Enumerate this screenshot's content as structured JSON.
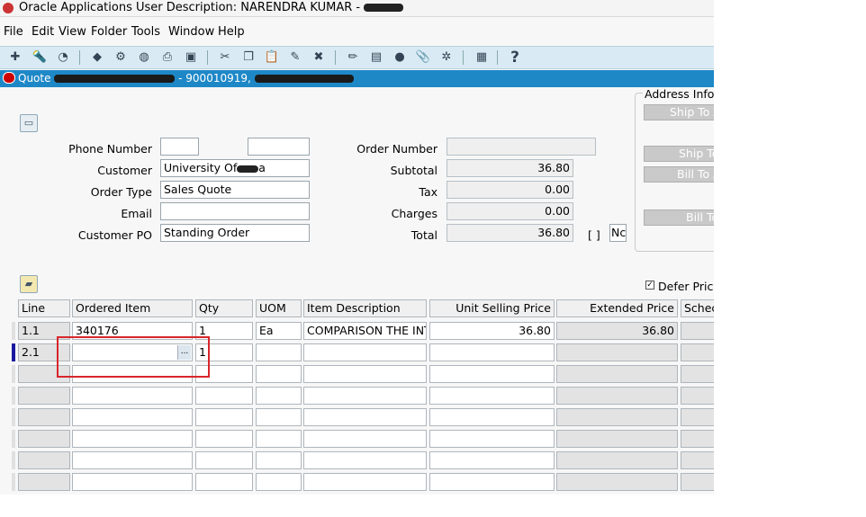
{
  "window": {
    "title": "Oracle Applications User Description: NARENDRA KUMAR -"
  },
  "menu": {
    "items": [
      "File",
      "Edit",
      "View",
      "Folder",
      "Tools",
      "Window",
      "Help"
    ]
  },
  "toolbar": {
    "icons": [
      "new-icon",
      "find-icon",
      "navigator-icon",
      "save-icon",
      "next-step-icon",
      "switch-responsibility-icon",
      "print-icon",
      "close-form-icon",
      "cut-icon",
      "copy-icon",
      "paste-icon",
      "clear-record-icon",
      "delete-record-icon",
      "edit-field-icon",
      "zoom-icon",
      "translations-icon",
      "attachments-icon",
      "folder-tools-icon",
      "window-help-icon",
      "help-icon"
    ],
    "help_glyph": "?"
  },
  "form": {
    "name": "Quote",
    "number": "- 900010919,"
  },
  "header": {
    "phone_label": "Phone Number",
    "phone_value1": "",
    "phone_value2": "",
    "customer_label": "Customer",
    "customer_value": "University Of",
    "customer_tail": "a",
    "order_type_label": "Order Type",
    "order_type_value": "Sales Quote",
    "email_label": "Email",
    "email_value": "",
    "customer_po_label": "Customer PO",
    "customer_po_value": "Standing Order",
    "order_number_label": "Order Number",
    "order_number_value": "",
    "subtotal_label": "Subtotal",
    "subtotal_value": "36.80",
    "tax_label": "Tax",
    "tax_value": "0.00",
    "charges_label": "Charges",
    "charges_value": "0.00",
    "total_label": "Total",
    "total_value": "36.80",
    "bracket": "[ ]",
    "nc_value": "Nc"
  },
  "address": {
    "title": "Address Inforr",
    "buttons": [
      "Ship To A",
      "Ship To",
      "Bill To A",
      "Bill To"
    ]
  },
  "lines": {
    "defer_pricing_label": "Defer Pricin",
    "defer_pricing_checked": true,
    "columns": [
      "Line",
      "Ordered Item",
      "Qty",
      "UOM",
      "Item Description",
      "Unit Selling Price",
      "Extended Price",
      "Schec"
    ],
    "rows": [
      {
        "line": "1.1",
        "item": "340176",
        "qty": "1",
        "uom": "Ea",
        "desc": "COMPARISON THE INTI",
        "unit_price": "36.80",
        "ext_price": "36.80",
        "sched": ""
      },
      {
        "line": "2.1",
        "item": "",
        "qty": "1",
        "uom": "",
        "desc": "",
        "unit_price": "",
        "ext_price": "",
        "sched": ""
      }
    ],
    "lov_glyph": "..."
  }
}
